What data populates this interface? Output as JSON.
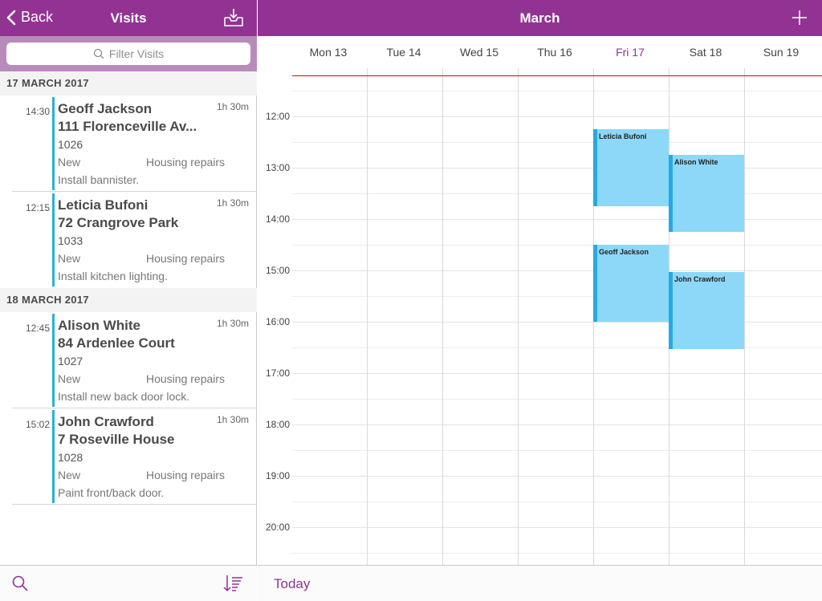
{
  "left": {
    "nav": {
      "back_label": "Back",
      "title": "Visits"
    },
    "search": {
      "placeholder": "Filter Visits"
    },
    "sections": [
      {
        "header": "17 MARCH 2017",
        "visits": [
          {
            "time": "14:30",
            "name": "Geoff Jackson",
            "address": "111 Florenceville Av...",
            "number": "1026",
            "status": "New",
            "type": "Housing repairs",
            "description": "Install bannister.",
            "duration": "1h 30m"
          },
          {
            "time": "12:15",
            "name": "Leticia Bufoni",
            "address": "72 Crangrove Park",
            "number": "1033",
            "status": "New",
            "type": "Housing repairs",
            "description": "Install kitchen lighting.",
            "duration": "1h 30m"
          }
        ]
      },
      {
        "header": "18 MARCH 2017",
        "visits": [
          {
            "time": "12:45",
            "name": "Alison White",
            "address": "84 Ardenlee Court",
            "number": "1027",
            "status": "New",
            "type": "Housing repairs",
            "description": "Install new back door lock.",
            "duration": "1h 30m"
          },
          {
            "time": "15:02",
            "name": "John Crawford",
            "address": "7 Roseville House",
            "number": "1028",
            "status": "New",
            "type": "Housing repairs",
            "description": "Paint front/back door.",
            "duration": "1h 30m"
          }
        ]
      }
    ]
  },
  "right": {
    "nav": {
      "title": "March"
    },
    "days": [
      "Mon 13",
      "Tue 14",
      "Wed 15",
      "Thu 16",
      "Fri 17",
      "Sat 18",
      "Sun 19"
    ],
    "today_index": 4,
    "hours": [
      "12:00",
      "13:00",
      "14:00",
      "15:00",
      "16:00",
      "17:00",
      "18:00",
      "19:00",
      "20:00"
    ],
    "events": [
      {
        "title": "Leticia Bufoni",
        "day_index": 4,
        "start": "12:15",
        "duration_hours": 1.5
      },
      {
        "title": "Alison White",
        "day_index": 5,
        "start": "12:45",
        "duration_hours": 1.5
      },
      {
        "title": "Geoff Jackson",
        "day_index": 4,
        "start": "14:30",
        "duration_hours": 1.5
      },
      {
        "title": "John Crawford",
        "day_index": 5,
        "start": "15:02",
        "duration_hours": 1.5
      }
    ],
    "footer": {
      "today_label": "Today"
    }
  },
  "colors": {
    "brand": "#923393",
    "event_fill": "#8dd8f8",
    "event_accent": "#27a9e1",
    "visit_accent": "#27b3ce",
    "current_time_line": "#d0021b"
  },
  "icons": {
    "back": "chevron-left-icon",
    "inbox": "inbox-download-icon",
    "add": "plus-icon",
    "search": "search-icon",
    "sort": "sort-icon"
  }
}
